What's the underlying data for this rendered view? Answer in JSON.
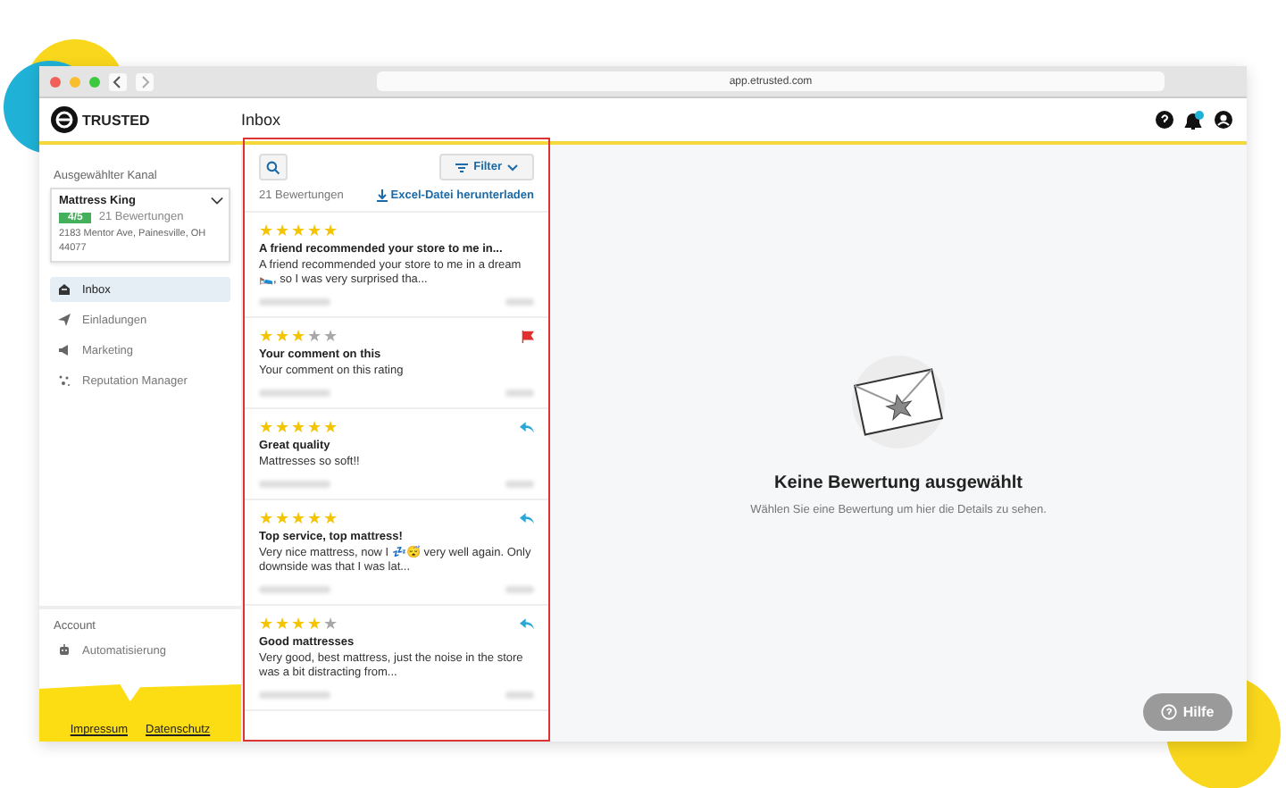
{
  "browser": {
    "url": "app.etrusted.com"
  },
  "header": {
    "logo": "TRUSTED",
    "title": "Inbox"
  },
  "sidebar": {
    "channel_label": "Ausgewählter Kanal",
    "channel": {
      "name": "Mattress King",
      "rating": "4/5",
      "count": "21 Bewertungen",
      "address": "2183 Mentor Ave, Painesville, OH 44077"
    },
    "items": [
      {
        "label": "Inbox",
        "kind": "inbox",
        "selected": true
      },
      {
        "label": "Einladungen",
        "kind": "send",
        "selected": false
      },
      {
        "label": "Marketing",
        "kind": "megaphone",
        "selected": false
      },
      {
        "label": "Reputation Manager",
        "kind": "sparkle",
        "selected": false
      }
    ],
    "account_label": "Account",
    "account_items": [
      {
        "label": "Automatisierung",
        "kind": "robot",
        "selected": false
      }
    ],
    "footer_links": [
      "Impressum",
      "Datenschutz"
    ]
  },
  "list": {
    "filter": "Filter",
    "count": "21 Bewertungen",
    "download": "Excel-Datei herunterladen",
    "reviews": [
      {
        "stars": 5,
        "kind": "plain",
        "title": "A friend recommended your store to me in...",
        "body": "A friend recommended your store to me in a dream 🛌, so I was very surprised tha..."
      },
      {
        "stars": 3,
        "kind": "flagged",
        "title": "Your comment on this",
        "body": "Your comment on this rating"
      },
      {
        "stars": 5,
        "kind": "replied",
        "title": "Great quality",
        "body": "Mattresses so soft!!"
      },
      {
        "stars": 5,
        "kind": "replied",
        "title": "Top service, top mattress!",
        "body": "Very nice mattress, now I 💤😴 very well again. Only downside was that I was lat..."
      },
      {
        "stars": 4,
        "kind": "replied",
        "title": "Good mattresses",
        "body": "Very good, best mattress, just the noise in the store was a bit distracting from..."
      }
    ]
  },
  "detail": {
    "title": "Keine Bewertung ausgewählt",
    "subtitle": "Wählen Sie eine Bewertung um hier die Details zu sehen."
  },
  "help_button": "Hilfe"
}
